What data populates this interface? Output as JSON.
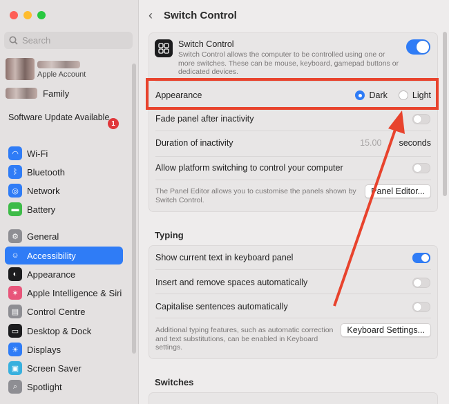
{
  "sidebar": {
    "search_placeholder": "Search",
    "account_label": "Apple Account",
    "family_label": "Family",
    "software_update": "Software Update Available",
    "update_badge": "1",
    "items": [
      {
        "label": "Wi-Fi",
        "icon": "wifi-icon",
        "color": "#2f7cf6"
      },
      {
        "label": "Bluetooth",
        "icon": "bluetooth-icon",
        "color": "#2f7cf6"
      },
      {
        "label": "Network",
        "icon": "globe-icon",
        "color": "#2f7cf6"
      },
      {
        "label": "Battery",
        "icon": "battery-icon",
        "color": "#3dbb48"
      },
      {
        "label": "General",
        "icon": "gear-icon",
        "color": "#8e8e93"
      },
      {
        "label": "Accessibility",
        "icon": "accessibility-icon",
        "color": "#2f7cf6"
      },
      {
        "label": "Appearance",
        "icon": "appearance-icon",
        "color": "#1c1c1e"
      },
      {
        "label": "Apple Intelligence & Siri",
        "icon": "siri-icon",
        "color": "#e8557a"
      },
      {
        "label": "Control Centre",
        "icon": "control-centre-icon",
        "color": "#8e8e93"
      },
      {
        "label": "Desktop & Dock",
        "icon": "dock-icon",
        "color": "#1c1c1e"
      },
      {
        "label": "Displays",
        "icon": "display-icon",
        "color": "#2f7cf6"
      },
      {
        "label": "Screen Saver",
        "icon": "screen-saver-icon",
        "color": "#38b0de"
      },
      {
        "label": "Spotlight",
        "icon": "spotlight-icon",
        "color": "#8e8e93"
      }
    ]
  },
  "header": {
    "title": "Switch Control"
  },
  "switch_control": {
    "title": "Switch Control",
    "description": "Switch Control allows the computer to be controlled using one or more switches. These can be mouse, keyboard, gamepad buttons or dedicated devices.",
    "enabled": true
  },
  "appearance": {
    "label": "Appearance",
    "options": [
      "Dark",
      "Light"
    ],
    "selected": "Dark"
  },
  "fade_panel": {
    "label": "Fade panel after inactivity",
    "enabled": false
  },
  "duration": {
    "label": "Duration of inactivity",
    "value": "15.00",
    "unit": "seconds"
  },
  "platform_switching": {
    "label": "Allow platform switching to control your computer",
    "enabled": false
  },
  "panel_editor": {
    "description": "The Panel Editor allows you to customise the panels shown by Switch Control.",
    "button": "Panel Editor..."
  },
  "typing": {
    "heading": "Typing",
    "show_text": "Show current text in keyboard panel",
    "insert_spaces": "Insert and remove spaces automatically",
    "capitalise": "Capitalise sentences automatically",
    "description": "Additional typing features, such as automatic correction and text substitutions, can be enabled in Keyboard settings.",
    "button": "Keyboard Settings..."
  },
  "switches": {
    "heading": "Switches"
  },
  "colors": {
    "accent": "#2f7cf6",
    "highlight": "#e8432d"
  }
}
